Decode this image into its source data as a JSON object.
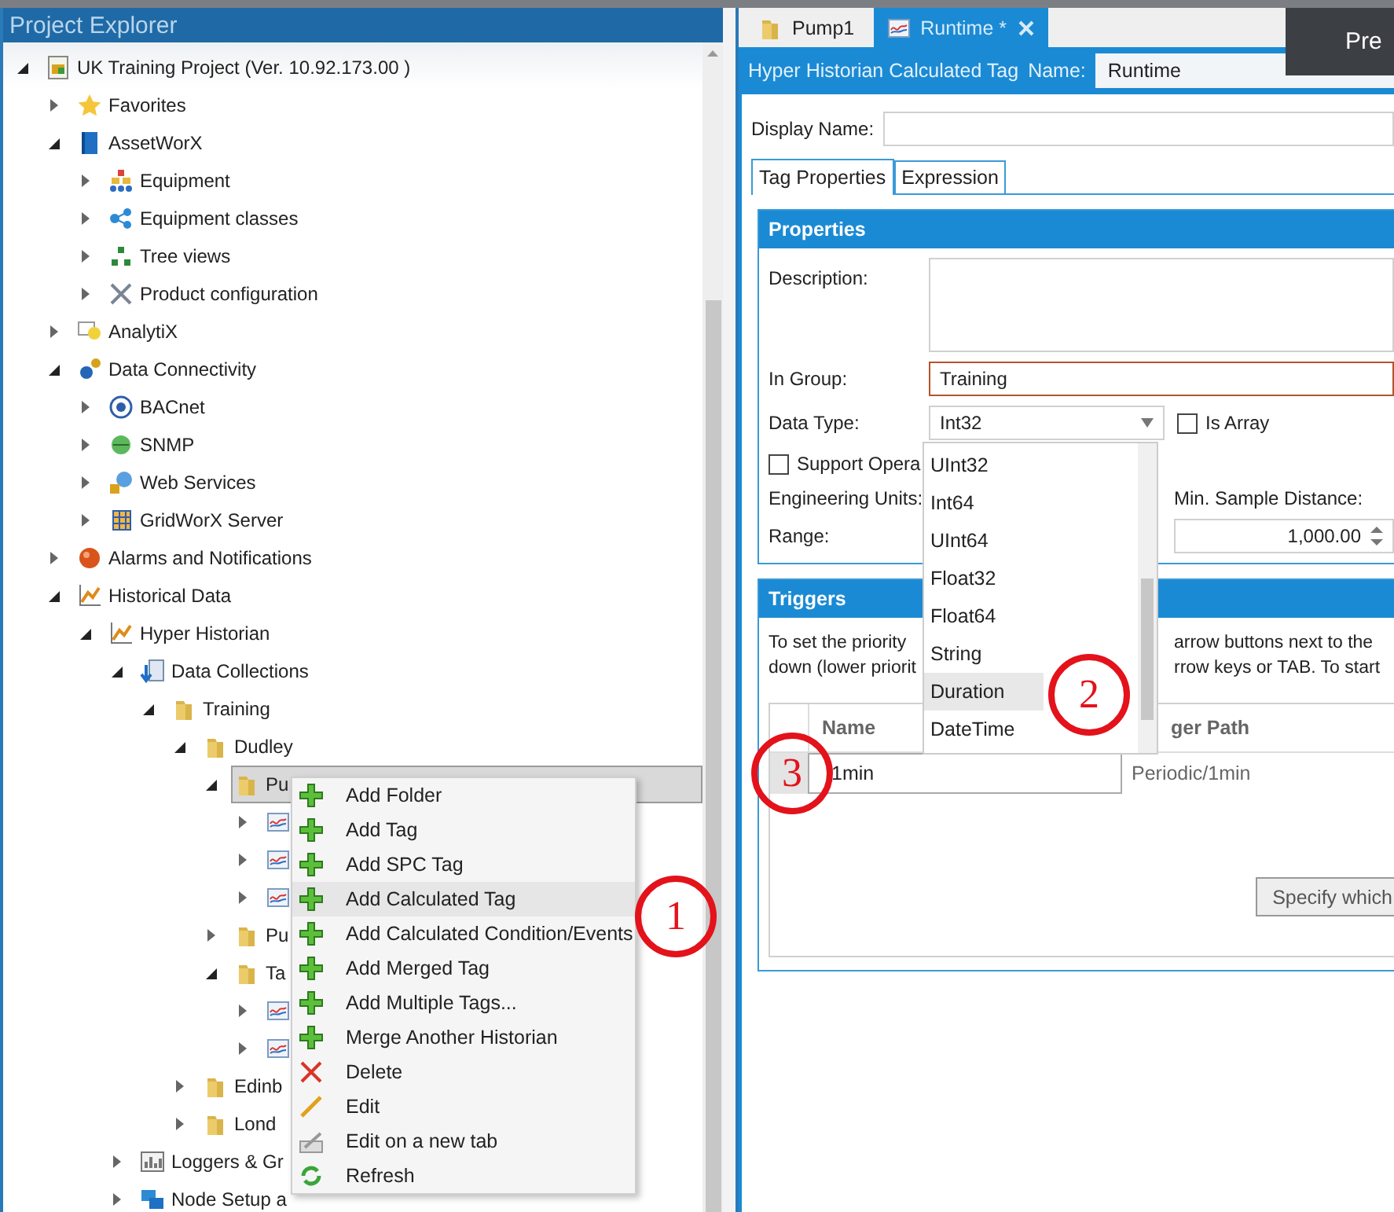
{
  "explorer": {
    "title": "Project Explorer",
    "tree": [
      {
        "label": "UK Training Project (Ver. 10.92.173.00 )",
        "kind": "project",
        "expanded": true,
        "selected": false,
        "children": [
          {
            "label": "Favorites",
            "kind": "star",
            "expanded": false,
            "selected": false
          },
          {
            "label": "AssetWorX",
            "kind": "book",
            "expanded": true,
            "selected": false,
            "children": [
              {
                "label": "Equipment",
                "kind": "equipment",
                "expanded": false,
                "selected": false
              },
              {
                "label": "Equipment classes",
                "kind": "classes",
                "expanded": false,
                "selected": false
              },
              {
                "label": "Tree views",
                "kind": "treeviews",
                "expanded": false,
                "selected": false
              },
              {
                "label": "Product configuration",
                "kind": "tools",
                "expanded": false,
                "selected": false
              }
            ]
          },
          {
            "label": "AnalytiX",
            "kind": "analytix",
            "expanded": false,
            "selected": false
          },
          {
            "label": "Data Connectivity",
            "kind": "connectivity",
            "expanded": true,
            "selected": false,
            "children": [
              {
                "label": "BACnet",
                "kind": "bacnet",
                "expanded": false,
                "selected": false
              },
              {
                "label": "SNMP",
                "kind": "snmp",
                "expanded": false,
                "selected": false
              },
              {
                "label": "Web Services",
                "kind": "globe",
                "expanded": false,
                "selected": false
              },
              {
                "label": "GridWorX Server",
                "kind": "gridworx",
                "expanded": false,
                "selected": false
              }
            ]
          },
          {
            "label": "Alarms and Notifications",
            "kind": "alarm",
            "expanded": false,
            "selected": false
          },
          {
            "label": "Historical Data",
            "kind": "chart",
            "expanded": true,
            "selected": false,
            "children": [
              {
                "label": "Hyper Historian",
                "kind": "chart",
                "expanded": true,
                "selected": false,
                "children": [
                  {
                    "label": "Data Collections",
                    "kind": "collections",
                    "expanded": true,
                    "selected": false,
                    "children": [
                      {
                        "label": "Training",
                        "kind": "folder",
                        "expanded": true,
                        "selected": false,
                        "children": [
                          {
                            "label": "Dudley",
                            "kind": "folder",
                            "expanded": true,
                            "selected": false,
                            "children": [
                              {
                                "label": "Pu",
                                "kind": "folder",
                                "expanded": true,
                                "selected": true,
                                "children": [
                                  {
                                    "kind": "tag",
                                    "expanded": false,
                                    "selected": false
                                  },
                                  {
                                    "kind": "tag",
                                    "expanded": false,
                                    "selected": false
                                  },
                                  {
                                    "kind": "tag",
                                    "expanded": false,
                                    "selected": false
                                  }
                                ]
                              },
                              {
                                "label": "Pu",
                                "kind": "folder",
                                "expanded": false,
                                "selected": false
                              },
                              {
                                "label": "Ta",
                                "kind": "folder",
                                "expanded": true,
                                "selected": false,
                                "children": [
                                  {
                                    "kind": "tag",
                                    "expanded": false,
                                    "selected": false
                                  },
                                  {
                                    "kind": "tag",
                                    "expanded": false,
                                    "selected": false
                                  }
                                ]
                              }
                            ]
                          },
                          {
                            "label": "Edinb",
                            "kind": "folder",
                            "expanded": false,
                            "selected": false
                          },
                          {
                            "label": "Lond",
                            "kind": "folder",
                            "expanded": false,
                            "selected": false
                          }
                        ]
                      }
                    ]
                  },
                  {
                    "label": "Loggers & Gr",
                    "kind": "loggers",
                    "expanded": false,
                    "selected": false
                  },
                  {
                    "label": "Node Setup a",
                    "kind": "node",
                    "expanded": false,
                    "selected": false
                  }
                ]
              }
            ]
          }
        ]
      }
    ]
  },
  "context_menu": {
    "items": [
      {
        "label": "Add Folder",
        "kind": "add",
        "highlighted": false
      },
      {
        "label": "Add Tag",
        "kind": "add",
        "highlighted": false
      },
      {
        "label": "Add SPC Tag",
        "kind": "add",
        "highlighted": false
      },
      {
        "label": "Add Calculated Tag",
        "kind": "add",
        "highlighted": true
      },
      {
        "label": "Add Calculated Condition/Events",
        "kind": "add",
        "highlighted": false
      },
      {
        "label": "Add Merged Tag",
        "kind": "add",
        "highlighted": false
      },
      {
        "label": "Add Multiple Tags...",
        "kind": "add",
        "highlighted": false
      },
      {
        "label": "Merge Another Historian",
        "kind": "add",
        "highlighted": false
      },
      {
        "label": "Delete",
        "kind": "delete",
        "highlighted": false
      },
      {
        "label": "Edit",
        "kind": "edit",
        "highlighted": false
      },
      {
        "label": "Edit on a new tab",
        "kind": "edit-tab",
        "highlighted": false
      },
      {
        "label": "Refresh",
        "kind": "refresh",
        "highlighted": false
      }
    ]
  },
  "editor": {
    "tabs": [
      {
        "label": "Pump1",
        "kind": "folder",
        "selected": false
      },
      {
        "label": "Runtime *",
        "kind": "tag",
        "selected": true
      }
    ],
    "header": {
      "title": "Hyper Historian Calculated Tag",
      "name_label": "Name:",
      "name_value": "Runtime"
    },
    "display_name": {
      "label": "Display Name:"
    },
    "subtabs": [
      {
        "label": "Tag Properties",
        "selected": true
      },
      {
        "label": "Expression",
        "selected": false
      }
    ],
    "properties": {
      "title": "Properties",
      "description_label": "Description:",
      "group_label": "In Group:",
      "group_value": "Training",
      "data_type_label": "Data Type:",
      "data_type_value": "Int32",
      "is_array": {
        "label": "Is Array",
        "checked": false
      },
      "support_operations": {
        "label": "Support Opera",
        "checked": false
      },
      "engineering_units_label": "Engineering Units:",
      "range_label": "Range:",
      "min_sample_label": "Min. Sample Distance:",
      "min_sample_value": "1,000.00"
    },
    "data_type_dropdown": {
      "items": [
        {
          "label": "UInt32",
          "highlighted": false
        },
        {
          "label": "Int64",
          "highlighted": false
        },
        {
          "label": "UInt64",
          "highlighted": false
        },
        {
          "label": "Float32",
          "highlighted": false
        },
        {
          "label": "Float64",
          "highlighted": false
        },
        {
          "label": "String",
          "highlighted": false
        },
        {
          "label": "Duration",
          "highlighted": true
        },
        {
          "label": "DateTime",
          "highlighted": false
        }
      ]
    },
    "triggers": {
      "title": "Triggers",
      "hint_lines": [
        {
          "left": "To set the priority",
          "right": "arrow buttons next to the"
        },
        {
          "left": "down (lower priorit",
          "right": "rrow keys or TAB. To start"
        }
      ],
      "columns": [
        "Name",
        "ger Path"
      ],
      "rows": [
        {
          "name": "1min",
          "path": "Periodic/1min"
        }
      ],
      "button": "Specify which"
    }
  },
  "overlay": {
    "text": "Pre"
  },
  "annotations": [
    {
      "label": "1"
    },
    {
      "label": "2"
    },
    {
      "label": "3"
    }
  ]
}
